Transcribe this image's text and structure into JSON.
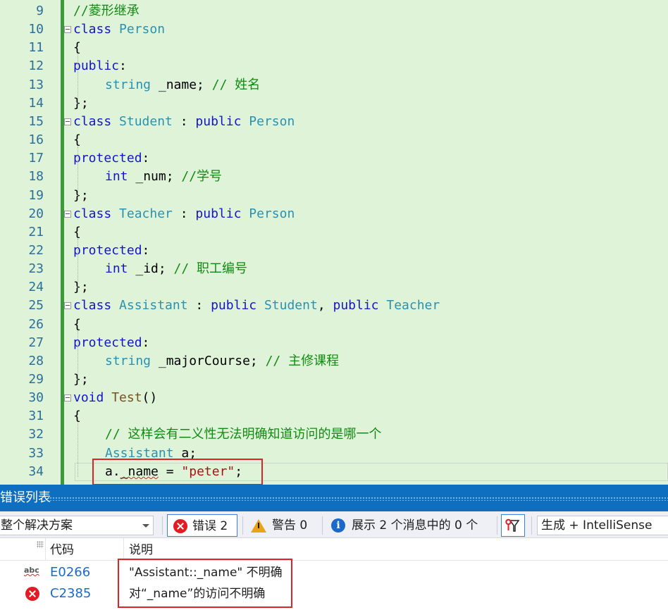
{
  "editor": {
    "lines": [
      {
        "no": "9",
        "indent": 0,
        "fold": false,
        "tokens": [
          {
            "t": "//菱形继承",
            "c": "cm"
          }
        ]
      },
      {
        "no": "10",
        "indent": 0,
        "fold": true,
        "tokens": [
          {
            "t": "class ",
            "c": "kw"
          },
          {
            "t": "Person",
            "c": "ty"
          }
        ]
      },
      {
        "no": "11",
        "indent": 0,
        "fold": false,
        "tokens": [
          {
            "t": "{",
            "c": ""
          }
        ]
      },
      {
        "no": "12",
        "indent": 0,
        "fold": false,
        "tokens": [
          {
            "t": "public",
            "c": "kw"
          },
          {
            "t": ":",
            "c": ""
          }
        ]
      },
      {
        "no": "13",
        "indent": 1,
        "fold": false,
        "tokens": [
          {
            "t": "string",
            "c": "ty"
          },
          {
            "t": " _name; ",
            "c": ""
          },
          {
            "t": "// 姓名",
            "c": "cm"
          }
        ]
      },
      {
        "no": "14",
        "indent": 0,
        "fold": false,
        "tokens": [
          {
            "t": "};",
            "c": ""
          }
        ]
      },
      {
        "no": "15",
        "indent": 0,
        "fold": true,
        "tokens": [
          {
            "t": "class ",
            "c": "kw"
          },
          {
            "t": "Student",
            "c": "ty"
          },
          {
            "t": " : ",
            "c": ""
          },
          {
            "t": "public ",
            "c": "kw"
          },
          {
            "t": "Person",
            "c": "ty"
          }
        ]
      },
      {
        "no": "16",
        "indent": 0,
        "fold": false,
        "tokens": [
          {
            "t": "{",
            "c": ""
          }
        ]
      },
      {
        "no": "17",
        "indent": 0,
        "fold": false,
        "tokens": [
          {
            "t": "protected",
            "c": "kw"
          },
          {
            "t": ":",
            "c": ""
          }
        ]
      },
      {
        "no": "18",
        "indent": 1,
        "fold": false,
        "tokens": [
          {
            "t": "int",
            "c": "kw"
          },
          {
            "t": " _num; ",
            "c": ""
          },
          {
            "t": "//学号",
            "c": "cm"
          }
        ]
      },
      {
        "no": "19",
        "indent": 0,
        "fold": false,
        "tokens": [
          {
            "t": "};",
            "c": ""
          }
        ]
      },
      {
        "no": "20",
        "indent": 0,
        "fold": true,
        "tokens": [
          {
            "t": "class ",
            "c": "kw"
          },
          {
            "t": "Teacher",
            "c": "ty"
          },
          {
            "t": " : ",
            "c": ""
          },
          {
            "t": "public ",
            "c": "kw"
          },
          {
            "t": "Person",
            "c": "ty"
          }
        ]
      },
      {
        "no": "21",
        "indent": 0,
        "fold": false,
        "tokens": [
          {
            "t": "{",
            "c": ""
          }
        ]
      },
      {
        "no": "22",
        "indent": 0,
        "fold": false,
        "tokens": [
          {
            "t": "protected",
            "c": "kw"
          },
          {
            "t": ":",
            "c": ""
          }
        ]
      },
      {
        "no": "23",
        "indent": 1,
        "fold": false,
        "tokens": [
          {
            "t": "int",
            "c": "kw"
          },
          {
            "t": " _id; ",
            "c": ""
          },
          {
            "t": "// 职工编号",
            "c": "cm"
          }
        ]
      },
      {
        "no": "24",
        "indent": 0,
        "fold": false,
        "tokens": [
          {
            "t": "};",
            "c": ""
          }
        ]
      },
      {
        "no": "25",
        "indent": 0,
        "fold": true,
        "tokens": [
          {
            "t": "class ",
            "c": "kw"
          },
          {
            "t": "Assistant",
            "c": "ty"
          },
          {
            "t": " : ",
            "c": ""
          },
          {
            "t": "public ",
            "c": "kw"
          },
          {
            "t": "Student",
            "c": "ty"
          },
          {
            "t": ", ",
            "c": ""
          },
          {
            "t": "public ",
            "c": "kw"
          },
          {
            "t": "Teacher",
            "c": "ty"
          }
        ]
      },
      {
        "no": "26",
        "indent": 0,
        "fold": false,
        "tokens": [
          {
            "t": "{",
            "c": ""
          }
        ]
      },
      {
        "no": "27",
        "indent": 0,
        "fold": false,
        "tokens": [
          {
            "t": "protected",
            "c": "kw"
          },
          {
            "t": ":",
            "c": ""
          }
        ]
      },
      {
        "no": "28",
        "indent": 1,
        "fold": false,
        "tokens": [
          {
            "t": "string",
            "c": "ty"
          },
          {
            "t": " _majorCourse; ",
            "c": ""
          },
          {
            "t": "// 主修课程",
            "c": "cm"
          }
        ]
      },
      {
        "no": "29",
        "indent": 0,
        "fold": false,
        "tokens": [
          {
            "t": "};",
            "c": ""
          }
        ]
      },
      {
        "no": "30",
        "indent": 0,
        "fold": true,
        "tokens": [
          {
            "t": "void ",
            "c": "kw"
          },
          {
            "t": "Test",
            "c": "fn"
          },
          {
            "t": "()",
            "c": ""
          }
        ]
      },
      {
        "no": "31",
        "indent": 0,
        "fold": false,
        "tokens": [
          {
            "t": "{",
            "c": ""
          }
        ]
      },
      {
        "no": "32",
        "indent": 1,
        "fold": false,
        "tokens": [
          {
            "t": "// 这样会有二义性无法明确知道访问的是哪一个",
            "c": "cm"
          }
        ]
      },
      {
        "no": "33",
        "indent": 1,
        "fold": false,
        "tokens": [
          {
            "t": "Assistant",
            "c": "ty"
          },
          {
            "t": " a;",
            "c": ""
          }
        ]
      },
      {
        "no": "34",
        "indent": 1,
        "fold": false,
        "tokens": [
          {
            "t": "a.",
            "c": ""
          },
          {
            "t": "_name",
            "c": "sq"
          },
          {
            "t": " = ",
            "c": ""
          },
          {
            "t": "\"peter\"",
            "c": "st"
          },
          {
            "t": ";",
            "c": ""
          }
        ]
      }
    ]
  },
  "error_list": {
    "title": "错误列表",
    "scope": "整个解决方案",
    "errors_label": "错误 2",
    "warnings_label": "警告 0",
    "messages_label": "展示 2 个消息中的 0 个",
    "build_scope": "生成 + IntelliSense",
    "columns": {
      "code": "代码",
      "description": "说明"
    },
    "rows": [
      {
        "icon": "intellisense-abc-icon",
        "code": "E0266",
        "description": "\"Assistant::_name\" 不明确"
      },
      {
        "icon": "error-icon",
        "code": "C2385",
        "description": "对“_name”的访问不明确"
      }
    ],
    "abc_icon_text": "abc"
  },
  "colors": {
    "editor_bg": "#dff3d9",
    "change_bar": "#3e9a3e",
    "title_bar": "#0e6fc1",
    "highlight_box": "#e0232a",
    "error_red": "#e31b23",
    "warning_amber": "#e8a317",
    "info_blue": "#1b6ac9"
  }
}
